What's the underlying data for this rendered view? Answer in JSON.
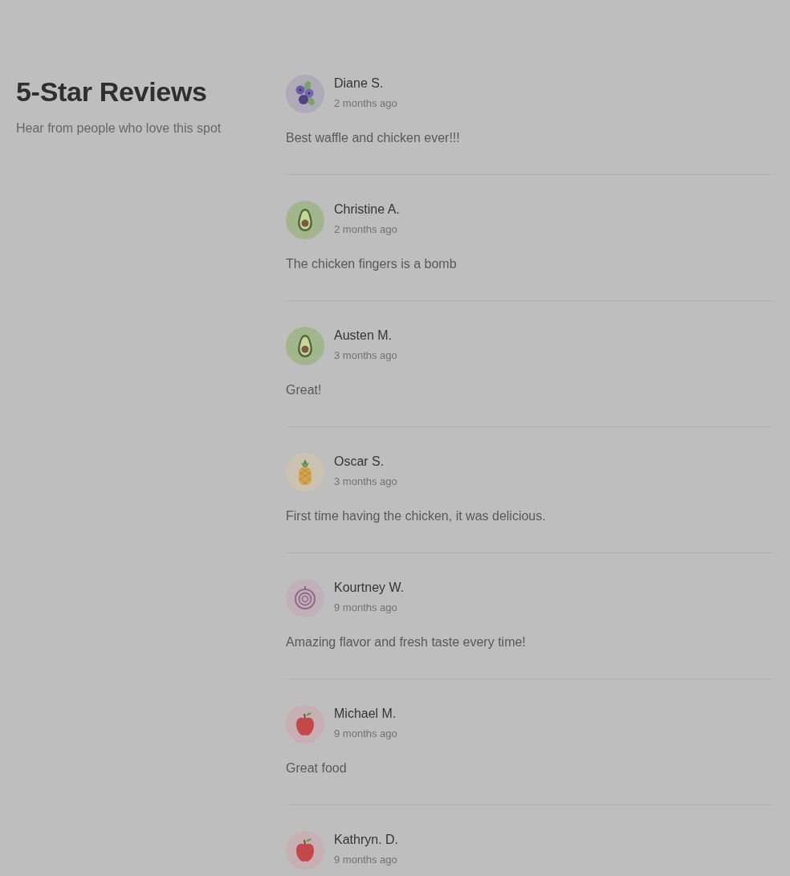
{
  "header": {
    "title": "5-Star Reviews",
    "subtitle": "Hear from people who love this spot"
  },
  "reviews": [
    {
      "kind": "blueberry",
      "name": "Diane S.",
      "time": "2 months ago",
      "text": "Best waffle and chicken ever!!!"
    },
    {
      "kind": "avocado",
      "name": "Christine A.",
      "time": "2 months ago",
      "text": "The chicken fingers is a bomb"
    },
    {
      "kind": "avocado",
      "name": "Austen M.",
      "time": "3 months ago",
      "text": "Great!"
    },
    {
      "kind": "pineapple",
      "name": "Oscar S.",
      "time": "3 months ago",
      "text": "First time having the chicken, it was delicious."
    },
    {
      "kind": "onion",
      "name": "Kourtney W.",
      "time": "9 months ago",
      "text": "Amazing flavor and fresh taste every time!"
    },
    {
      "kind": "apple",
      "name": "Michael M.",
      "time": "9 months ago",
      "text": "Great food"
    },
    {
      "kind": "apple",
      "name": "Kathryn. D.",
      "time": "9 months ago"
    }
  ]
}
